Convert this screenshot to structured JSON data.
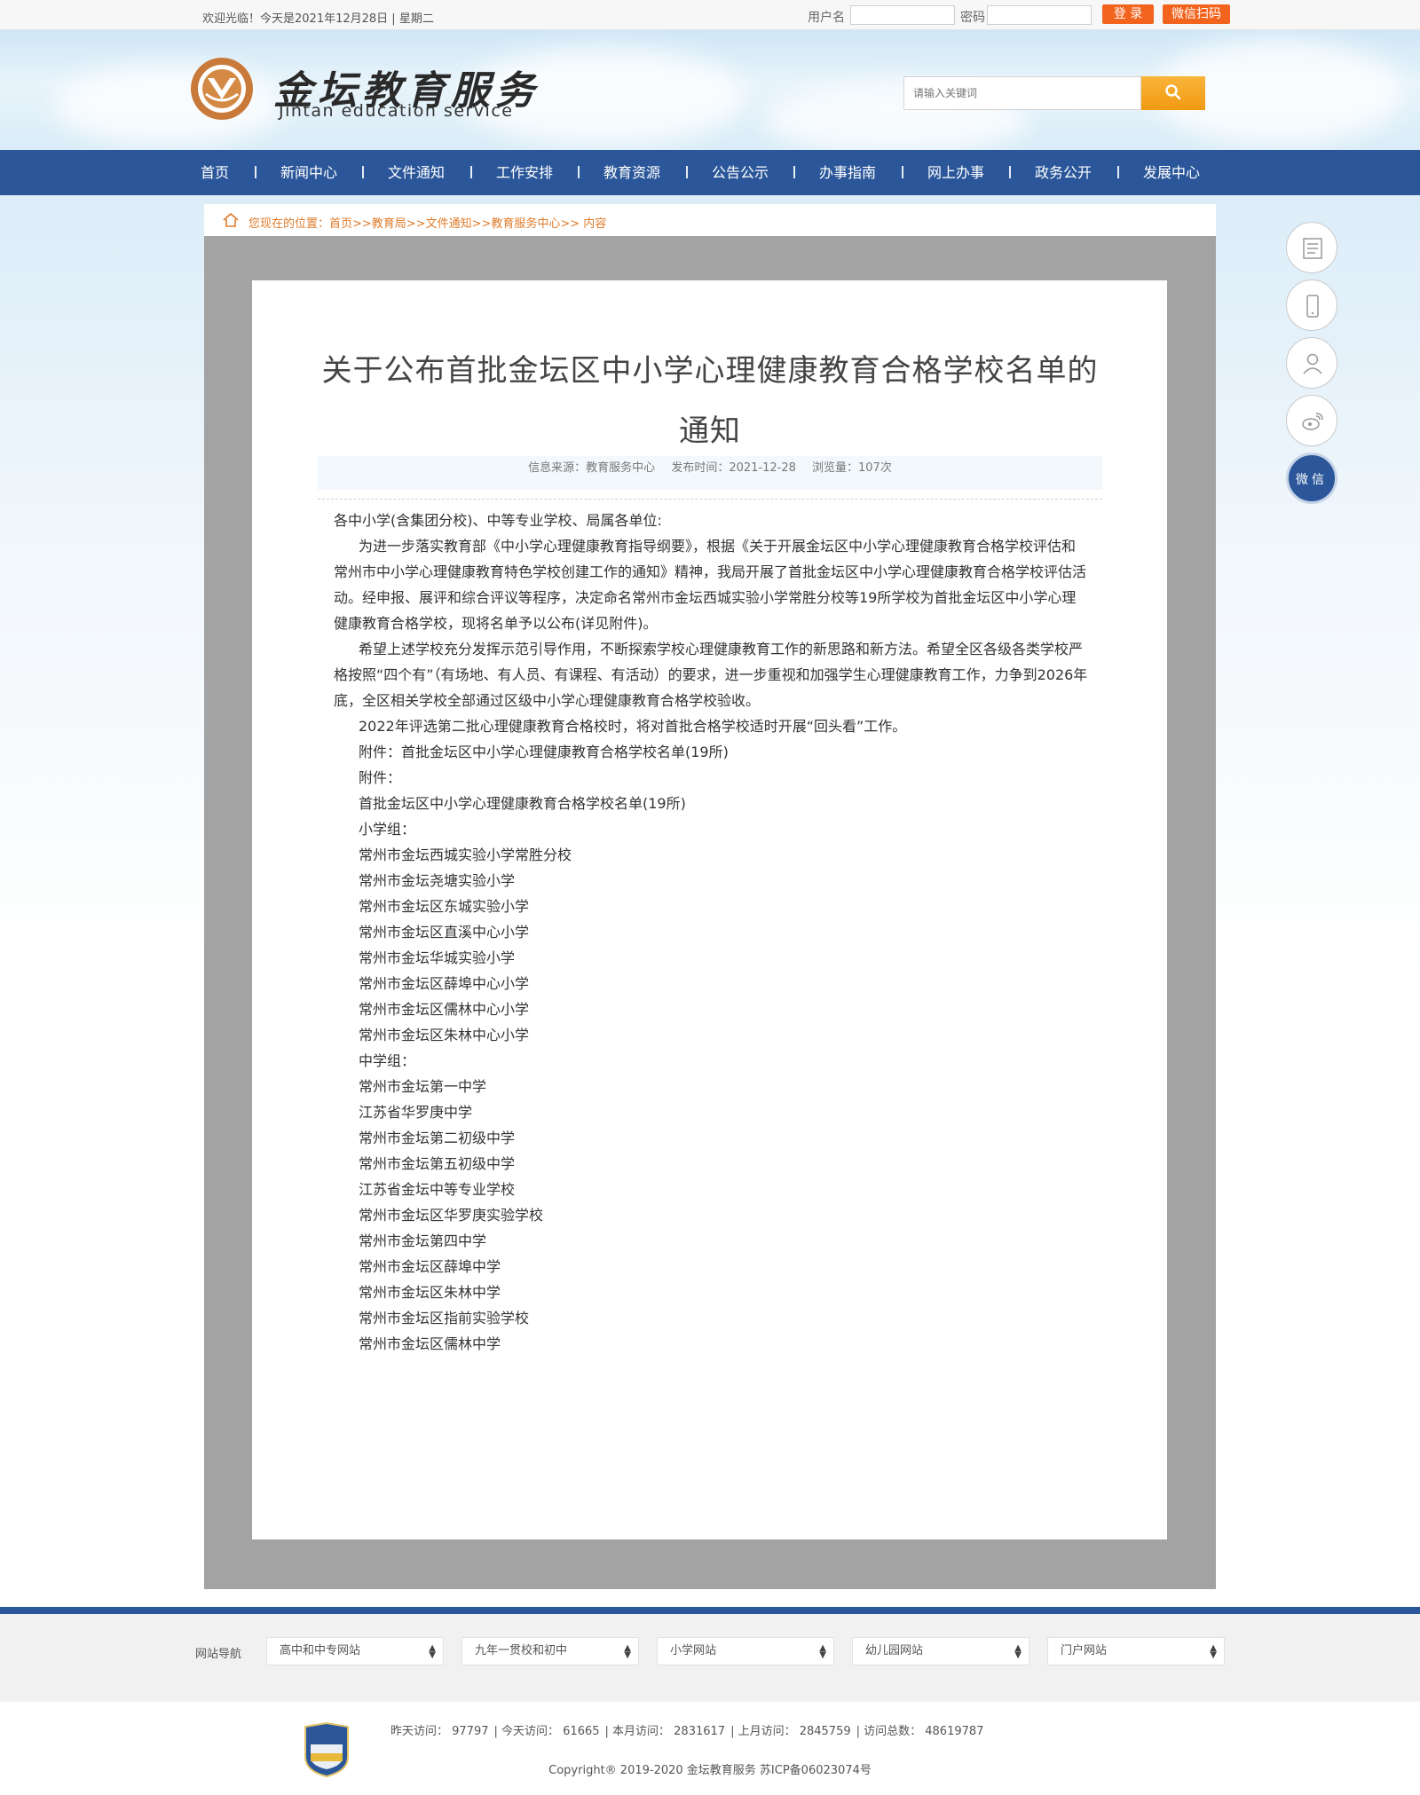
{
  "topbar": {
    "welcome": "欢迎光临！今天是2021年12月28日 | 星期二",
    "username_label": "用户名",
    "password_label": "密码",
    "login_button": "登 录",
    "wechat_button": "微信扫码"
  },
  "header": {
    "logo_title": "金坛教育服务",
    "logo_subtitle": "Jintan education service",
    "search_placeholder": "请输入关键词"
  },
  "nav": {
    "items": [
      "首页",
      "新闻中心",
      "文件通知",
      "工作安排",
      "教育资源",
      "公告公示",
      "办事指南",
      "网上办事",
      "政务公开",
      "发展中心"
    ]
  },
  "breadcrumb": {
    "text": "您现在的位置：首页>>教育局>>文件通知>>教育服务中心>> 内容"
  },
  "article": {
    "title": "关于公布首批金坛区中小学心理健康教育合格学校名单的通知",
    "source": "信息来源：教育服务中心",
    "date": "发布时间：2021-12-28",
    "views": "浏览量：107次",
    "greeting": "各中小学(含集团分校)、中等专业学校、局属各单位:",
    "para1": "为进一步落实教育部《中小学心理健康教育指导纲要》，根据《关于开展金坛区中小学心理健康教育合格学校评估和常州市中小学心理健康教育特色学校创建工作的通知》精神，我局开展了首批金坛区中小学心理健康教育合格学校评估活动。经申报、展评和综合评议等程序，决定命名常州市金坛西城实验小学常胜分校等19所学校为首批金坛区中小学心理健康教育合格学校，现将名单予以公布(详见附件)。",
    "para2": "希望上述学校充分发挥示范引导作用，不断探索学校心理健康教育工作的新思路和新方法。希望全区各级各类学校严格按照“四个有”（有场地、有人员、有课程、有活动）的要求，进一步重视和加强学生心理健康教育工作，力争到2026年底，全区相关学校全部通过区级中小学心理健康教育合格学校验收。",
    "para3": "2022年评选第二批心理健康教育合格校时，将对首批合格学校适时开展“回头看”工作。",
    "attachment_line": "附件：首批金坛区中小学心理健康教育合格学校名单(19所)",
    "attachment_label": "附件：",
    "list_title": "首批金坛区中小学心理健康教育合格学校名单(19所)",
    "primary_label": "小学组：",
    "primary_schools": [
      "常州市金坛西城实验小学常胜分校",
      "常州市金坛尧塘实验小学",
      "常州市金坛区东城实验小学",
      "常州市金坛区直溪中心小学",
      "常州市金坛华城实验小学",
      "常州市金坛区薛埠中心小学",
      "常州市金坛区儒林中心小学",
      "常州市金坛区朱林中心小学"
    ],
    "middle_label": "中学组：",
    "middle_schools": [
      "常州市金坛第一中学",
      "江苏省华罗庚中学",
      "常州市金坛第二初级中学",
      "常州市金坛第五初级中学",
      "江苏省金坛中等专业学校",
      "常州市金坛区华罗庚实验学校",
      "常州市金坛第四中学",
      "常州市金坛区薛埠中学",
      "常州市金坛区朱林中学",
      "常州市金坛区指前实验学校",
      "常州市金坛区儒林中学"
    ]
  },
  "side": {
    "wechat_label": "微信"
  },
  "footer": {
    "nav_label": "网站导航",
    "selects": [
      "高中和中专网站",
      "九年一贯校和初中",
      "小学网站",
      "幼儿园网站",
      "门户网站"
    ],
    "stats": [
      "昨天访问： 97797",
      "今天访问： 61665",
      "本月访问： 2831617",
      "上月访问： 2845759",
      "访问总数： 48619787"
    ],
    "badge_text": "事业单位",
    "copyright": "Copyright® 2019-2020 金坛教育服务 苏ICP备06023074号"
  },
  "colors": {
    "nav_blue": "#2b579a",
    "accent_orange": "#f2641e",
    "breadcrumb_orange": "#e07b2a"
  }
}
